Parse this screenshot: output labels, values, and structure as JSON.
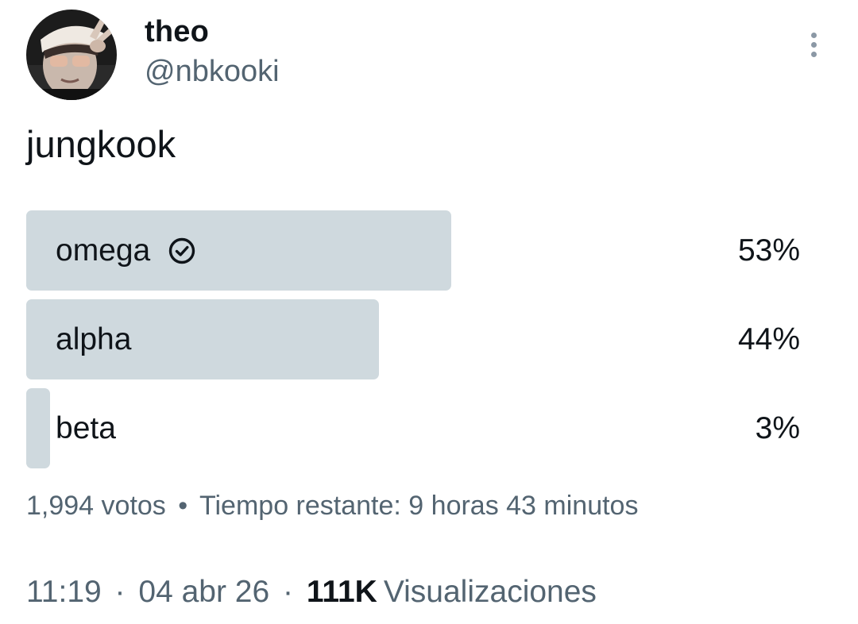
{
  "tweet": {
    "author": {
      "display_name": "theo",
      "handle": "@nbkooki"
    },
    "text": "jungkook",
    "poll": {
      "options": [
        {
          "label": "omega",
          "percent_text": "53%",
          "percent": 53,
          "selected": true
        },
        {
          "label": "alpha",
          "percent_text": "44%",
          "percent": 44,
          "selected": false
        },
        {
          "label": "beta",
          "percent_text": "3%",
          "percent": 3,
          "selected": false
        }
      ],
      "votes": "1,994 votos",
      "separator": "•",
      "time_remaining": "Tiempo restante: 9 horas 43 minutos"
    },
    "meta": {
      "time": "11:19",
      "date": "04 abr 26",
      "separator": "·",
      "views_count": "111K",
      "views_label": "Visualizaciones"
    }
  },
  "colors": {
    "poll_bar": "#cfd9de",
    "text_primary": "#0f1419",
    "text_secondary": "#536471",
    "more_dots": "#8b98a5"
  },
  "icons": {
    "more": "vertical-ellipsis-icon",
    "selected_check": "check-circle-icon"
  }
}
